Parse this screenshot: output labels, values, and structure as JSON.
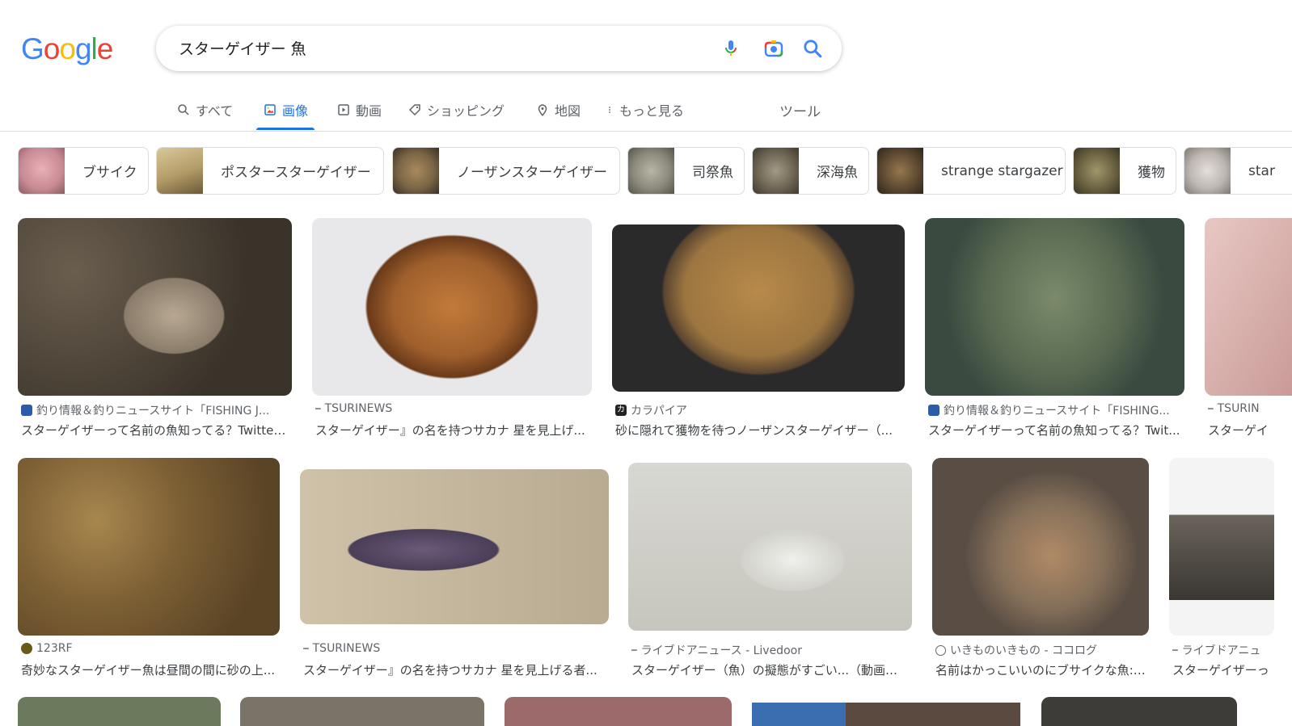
{
  "logo": {
    "letters": [
      "G",
      "o",
      "o",
      "g",
      "l",
      "e"
    ],
    "colors": [
      "#4285f4",
      "#ea4335",
      "#fbbc05",
      "#4285f4",
      "#34a853",
      "#ea4335"
    ]
  },
  "search": {
    "query": "スターゲイザー 魚"
  },
  "tabs": [
    {
      "label": "すべて",
      "icon": "search-icon"
    },
    {
      "label": "画像",
      "icon": "image-icon",
      "active": true
    },
    {
      "label": "動画",
      "icon": "video-icon"
    },
    {
      "label": "ショッピング",
      "icon": "tag-icon"
    },
    {
      "label": "地図",
      "icon": "map-pin-icon"
    },
    {
      "label": "もっと見る",
      "icon": "more-vert-icon"
    }
  ],
  "tools_label": "ツール",
  "chips": [
    {
      "label": "ブサイク",
      "color": "#c98a94"
    },
    {
      "label": "ポスタースターゲイザー",
      "color": "#b39b67"
    },
    {
      "label": "ノーザンスターゲイザー",
      "color": "#7a6546"
    },
    {
      "label": "司祭魚",
      "color": "#8c8a7c"
    },
    {
      "label": "深海魚",
      "color": "#6f6654"
    },
    {
      "label": "strange stargazer",
      "color": "#5e4a32"
    },
    {
      "label": "獲物",
      "color": "#6b6242"
    },
    {
      "label": "star",
      "color": "#bdb6b1"
    }
  ],
  "results": [
    {
      "source": "釣り情報＆釣りニュースサイト「FISHING J...",
      "title": "スターゲイザーって名前の魚知ってる？Twitter...",
      "favicon": "FJ",
      "img_color": "#4d4437"
    },
    {
      "source": "TSURINEWS",
      "title": "スターゲイザー』の名を持つサカナ 星を見上げ...",
      "favicon": "—",
      "img_color": "#a0602c"
    },
    {
      "source": "カラパイア",
      "title": "砂に隠れて獲物を待つノーザンスターゲイザー（...",
      "favicon": "カ",
      "img_color": "#9c7540"
    },
    {
      "source": "釣り情報＆釣りニュースサイト「FISHING...",
      "title": "スターゲイザーって名前の魚知ってる？Twit...",
      "favicon": "FJ",
      "img_color": "#5a6a52"
    },
    {
      "source": "TSURIN",
      "title": "スターゲイ",
      "favicon": "—",
      "img_color": "#d8b0ac"
    },
    {
      "source": "123RF",
      "title": "奇妙なスターゲイザー魚は昼間の間に砂の上...",
      "favicon": "●",
      "img_color": "#7c5f34"
    },
    {
      "source": "TSURINEWS",
      "title": "スターゲイザー』の名を持つサカナ 星を見上げる者...",
      "favicon": "—",
      "img_color": "#b9ab92"
    },
    {
      "source": "ライブドアニュース - Livedoor",
      "title": "スターゲイザー（魚）の擬態がすごい...（動画） ...",
      "favicon": "—",
      "img_color": "#d2d2cb"
    },
    {
      "source": "いきものいきもの - ココログ",
      "title": "名前はかっこいいのにブサイクな魚: ...",
      "favicon": "◎",
      "img_color": "#86705a"
    },
    {
      "source": "ライブドアニュ",
      "title": "スターゲイザーっ",
      "favicon": "—",
      "img_color": "#e6e6e6"
    }
  ],
  "bottom_row_colors": [
    "#6b7a5c",
    "#7a7468",
    "#9c6a6a",
    "#3a6eb0",
    "#3e3c38"
  ]
}
